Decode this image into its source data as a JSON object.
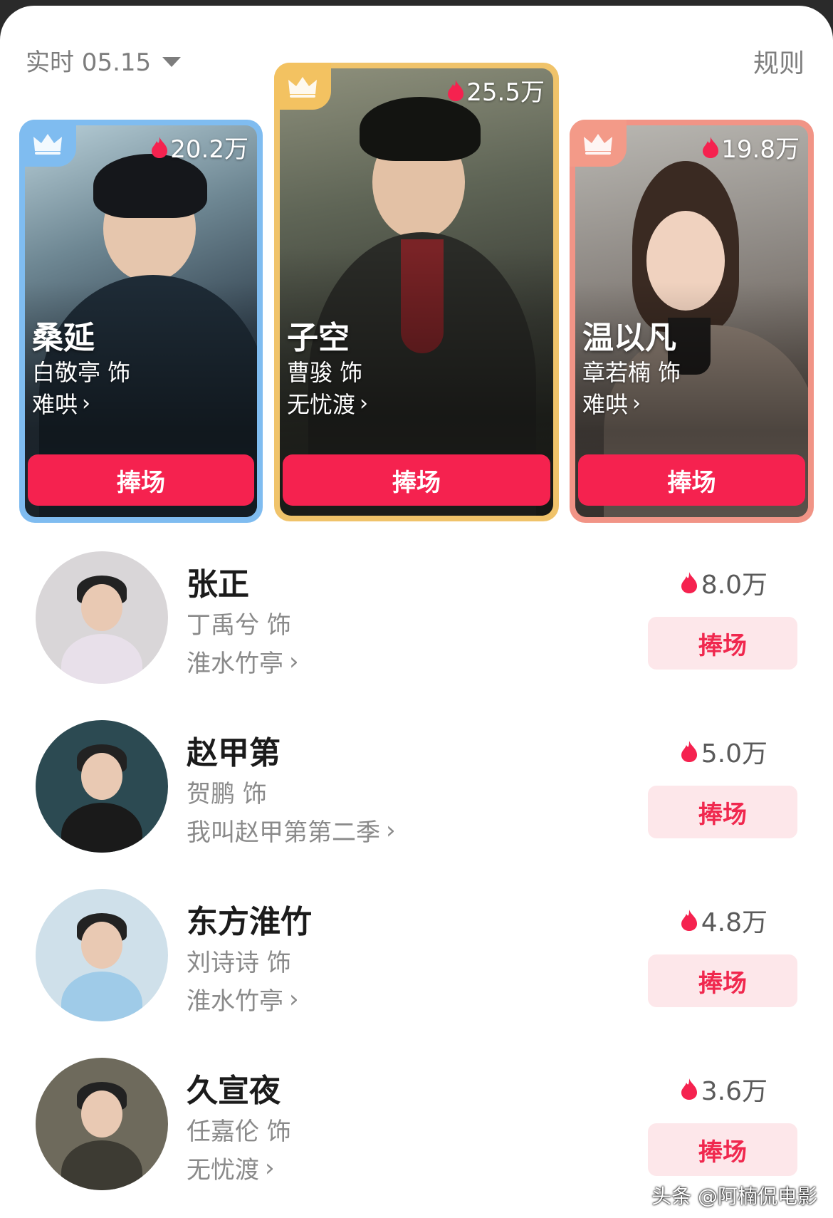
{
  "header": {
    "period": "实时 05.15",
    "rules": "规则"
  },
  "colors": {
    "accent": "#f5224f",
    "rank1": "#f0c36a",
    "rank2": "#7fbcf0",
    "rank3": "#f19486"
  },
  "top3": [
    {
      "rank": 2,
      "heat": "20.2万",
      "role": "桑延",
      "actor": "白敬亭 饰",
      "drama": "难哄",
      "cheer": "捧场"
    },
    {
      "rank": 1,
      "heat": "25.5万",
      "role": "子空",
      "actor": "曹骏 饰",
      "drama": "无忧渡",
      "cheer": "捧场"
    },
    {
      "rank": 3,
      "heat": "19.8万",
      "role": "温以凡",
      "actor": "章若楠 饰",
      "drama": "难哄",
      "cheer": "捧场"
    }
  ],
  "list": [
    {
      "role": "张正",
      "actor": "丁禹兮 饰",
      "drama": "淮水竹亭",
      "heat": "8.0万",
      "cheer": "捧场"
    },
    {
      "role": "赵甲第",
      "actor": "贺鹏 饰",
      "drama": "我叫赵甲第第二季",
      "heat": "5.0万",
      "cheer": "捧场"
    },
    {
      "role": "东方淮竹",
      "actor": "刘诗诗 饰",
      "drama": "淮水竹亭",
      "heat": "4.8万",
      "cheer": "捧场"
    },
    {
      "role": "久宣夜",
      "actor": "任嘉伦 饰",
      "drama": "无忧渡",
      "heat": "3.6万",
      "cheer": "捧场"
    }
  ],
  "watermark": "头条 @阿楠侃电影"
}
